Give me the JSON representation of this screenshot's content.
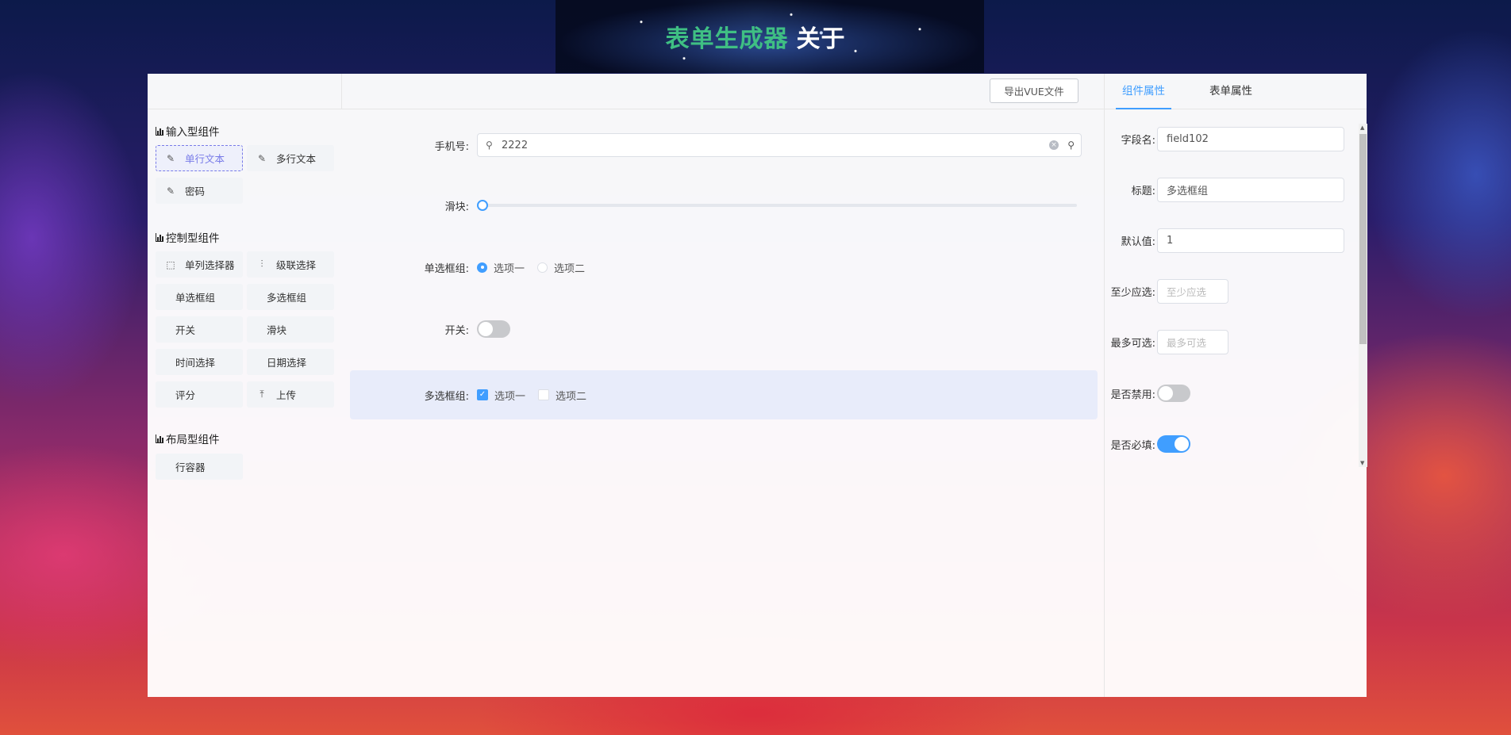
{
  "header": {
    "brand": "表单生成器",
    "about": "关于"
  },
  "left": {
    "groups": [
      {
        "title": "输入型组件",
        "items": [
          "单行文本",
          "多行文本",
          "密码"
        ]
      },
      {
        "title": "控制型组件",
        "items": [
          "单列选择器",
          "级联选择",
          "单选框组",
          "多选框组",
          "开关",
          "滑块",
          "时间选择",
          "日期选择",
          "评分",
          "上传"
        ]
      },
      {
        "title": "布局型组件",
        "items": [
          "行容器"
        ]
      }
    ]
  },
  "toolbar": {
    "export_label": "导出VUE文件"
  },
  "canvas": {
    "phone": {
      "label": "手机号:",
      "value": "2222"
    },
    "slider": {
      "label": "滑块:",
      "value": 0
    },
    "radio": {
      "label": "单选框组:",
      "options": [
        "选项一",
        "选项二"
      ],
      "selected": "选项一"
    },
    "switch": {
      "label": "开关:",
      "on": false
    },
    "checkbox": {
      "label": "多选框组:",
      "options": [
        "选项一",
        "选项二"
      ],
      "checked": [
        "选项一"
      ]
    }
  },
  "props": {
    "tabs": [
      "组件属性",
      "表单属性"
    ],
    "active_tab": "组件属性",
    "field_name": {
      "label": "字段名:",
      "value": "field102"
    },
    "title": {
      "label": "标题:",
      "value": "多选框组"
    },
    "default": {
      "label": "默认值:",
      "value": "1"
    },
    "min": {
      "label": "至少应选:",
      "placeholder": "至少应选"
    },
    "max": {
      "label": "最多可选:",
      "placeholder": "最多可选"
    },
    "disabled": {
      "label": "是否禁用:",
      "on": false
    },
    "required": {
      "label": "是否必填:",
      "on": true
    }
  },
  "colors": {
    "brand": "#3fbf83",
    "accent": "#409eff",
    "active_component": "#787be8"
  }
}
